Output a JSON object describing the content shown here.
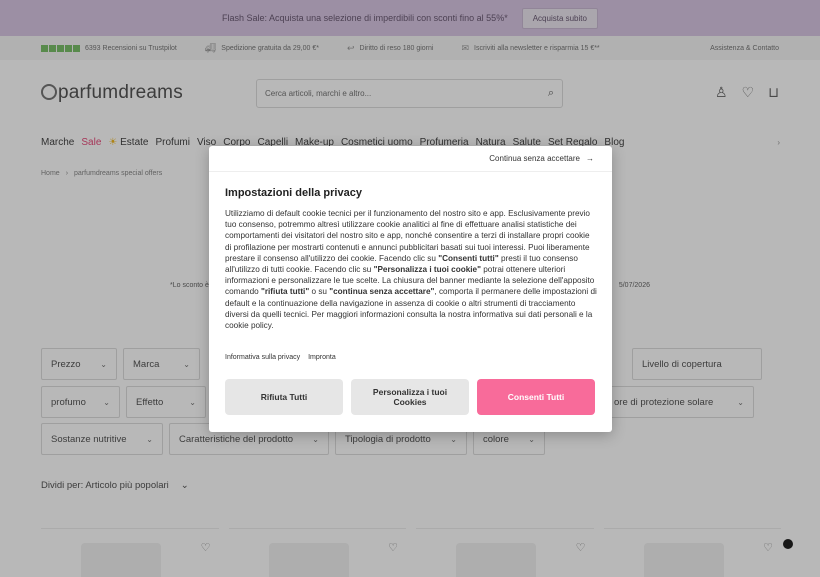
{
  "promo": {
    "text": "Flash Sale: Acquista una selezione di imperdibili con sconti fino al 55%*",
    "button": "Acquista subito"
  },
  "infobar": {
    "reviews": "6393 Recensioni su Trustpilot",
    "shipping": "Spedizione gratuita da 29,00 €*",
    "returns": "Diritto di reso 180 giorni",
    "newsletter": "Iscriviti alla newsletter e risparmia 15 €**",
    "support": "Assistenza & Contatto"
  },
  "header": {
    "logo": "parfumdreams",
    "search_placeholder": "Cerca articoli, marchi e altro..."
  },
  "nav": {
    "items": [
      "Marche",
      "Sale",
      "Estate",
      "Profumi",
      "Viso",
      "Corpo",
      "Capelli",
      "Make-up",
      "Cosmetici uomo",
      "Profumeria",
      "Natura",
      "Salute",
      "Set Regalo",
      "Blog"
    ]
  },
  "breadcrumb": {
    "home": "Home",
    "current": "parfumdreams special offers"
  },
  "disclaimer": {
    "left": "*Lo sconto è",
    "right": "5/07/2026"
  },
  "filters": {
    "row1": [
      "Prezzo",
      "Marca",
      "Livello di copertura"
    ],
    "row2": [
      "profumo",
      "Effetto",
      "ore di protezione solare"
    ],
    "row3": [
      "Sostanze nutritive",
      "Caratteristiche del prodotto",
      "Tipologia di prodotto",
      "colore"
    ]
  },
  "sort": {
    "label": "Dividi per: Articolo più popolari"
  },
  "modal": {
    "skip": "Continua senza accettare",
    "title": "Impostazioni della privacy",
    "p1": "Utilizziamo di default cookie tecnici per il funzionamento del nostro sito e app. Esclusivamente previo tuo consenso, potremmo altresì utilizzare cookie analitici al fine di effettuare analisi statistiche dei comportamenti dei visitatori del nostro sito e app, nonché consentire a terzi di installare propri cookie di profilazione per mostrarti contenuti e annunci pubblicitari basati sui tuoi interessi. Puoi liberamente prestare il consenso all'utilizzo dei cookie. Facendo clic su ",
    "b1": "\"Consenti tutti\"",
    "p2": " presti il tuo consenso all'utilizzo di tutti cookie. Facendo clic su ",
    "b2": "\"Personalizza i tuoi cookie\"",
    "p3": " potrai ottenere ulteriori informazioni e personalizzare le tue scelte. La chiusura del banner mediante la selezione dell'apposito comando ",
    "b3": "\"rifiuta tutti\"",
    "p4": " o su ",
    "b4": "\"continua senza accettare\"",
    "p5": ", comporta il permanere delle impostazioni di default e la continuazione della navigazione in assenza di cookie o altri strumenti di tracciamento diversi da quelli tecnici. Per maggiori informazioni consulta la nostra informativa sui dati personali e la cookie policy.",
    "link_privacy": "Informativa sulla privacy",
    "link_imprint": "Impronta",
    "btn_reject": "Rifiuta Tutti",
    "btn_customize": "Personalizza i tuoi Cookies",
    "btn_accept": "Consenti Tutti"
  },
  "colors": {
    "accent_pink": "#f86b9a",
    "promo_bg": "#d9c7e3",
    "sale_red": "#e64b7a",
    "trustpilot_green": "#7bbf6a"
  }
}
